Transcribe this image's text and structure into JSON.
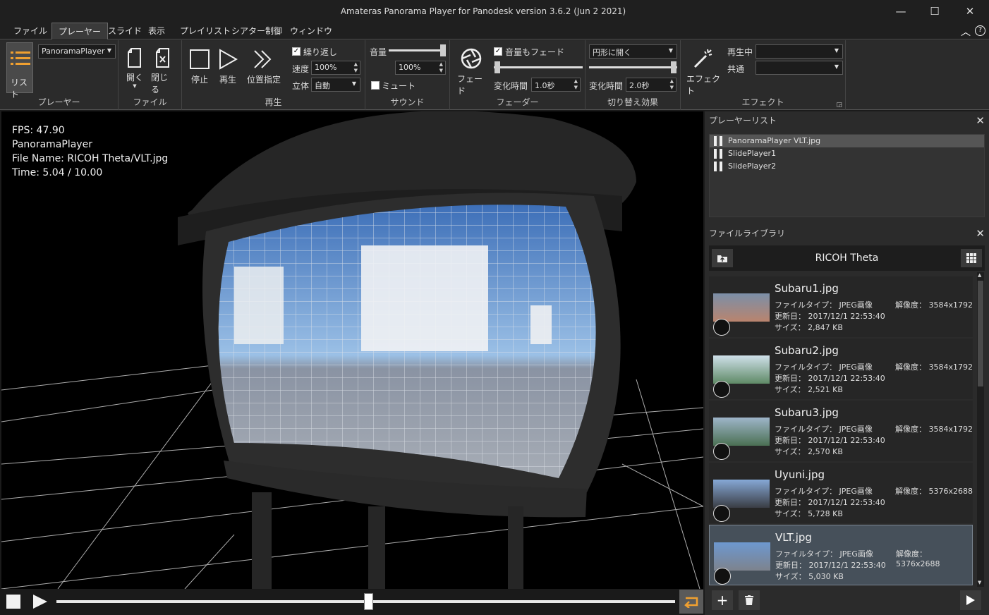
{
  "app": {
    "title": "Amateras Panorama Player for Panodesk version 3.6.2 (Jun  2 2021)"
  },
  "window": {
    "minimize": "—",
    "maximize": "☐",
    "close": "✕"
  },
  "menu": {
    "items": [
      "ファイル",
      "プレーヤー",
      "スライド",
      "表示",
      "プレイリスト",
      "シアター制御",
      "ウィンドウ"
    ],
    "active": "プレーヤー"
  },
  "ribbon": {
    "player": {
      "list_label": "リスト",
      "player_select": "PanoramaPlayer",
      "group": "プレーヤー"
    },
    "file": {
      "open": "開く",
      "close": "閉じる",
      "group": "ファイル"
    },
    "playback": {
      "stop": "停止",
      "play": "再生",
      "seek": "位置指定",
      "loop": "繰り返し",
      "speed_label": "速度",
      "speed_value": "100%",
      "stereo_label": "立体",
      "stereo_value": "自動",
      "group": "再生"
    },
    "sound": {
      "volume_label": "音量",
      "volume_value": "100%",
      "volume_level": 1.0,
      "mute": "ミュート",
      "group": "サウンド"
    },
    "fader": {
      "fade": "フェード",
      "fade_volume": "音量もフェード",
      "time_label": "変化時間",
      "time_value": "1.0秒",
      "group": "フェーダー"
    },
    "transition": {
      "mode": "円形に開く",
      "time_label": "変化時間",
      "time_value": "2.0秒",
      "group": "切り替え効果"
    },
    "effect": {
      "effect": "エフェクト",
      "playing_label": "再生中",
      "shared_label": "共通",
      "group": "エフェクト"
    }
  },
  "overlay": {
    "fps": "FPS: 47.90",
    "player": "PanoramaPlayer",
    "file": "File Name: RICOH Theta/VLT.jpg",
    "time": "Time: 5.04 / 10.00"
  },
  "transport": {
    "progress": 0.504
  },
  "player_list": {
    "title": "プレーヤーリスト",
    "items": [
      "PanoramaPlayer  VLT.jpg",
      "SlidePlayer1",
      "SlidePlayer2"
    ]
  },
  "library": {
    "title": "ファイルライブラリ",
    "folder": "RICOH Theta",
    "labels": {
      "type": "ファイルタイプ：",
      "date": "更新日：",
      "size": "サイズ：",
      "res": "解像度："
    },
    "files": [
      {
        "name": "Subaru1.jpg",
        "type": "JPEG画像",
        "date": "2017/12/1 22:53:40",
        "size": "2,847 KB",
        "res": "3584x1792"
      },
      {
        "name": "Subaru2.jpg",
        "type": "JPEG画像",
        "date": "2017/12/1 22:53:40",
        "size": "2,521 KB",
        "res": "3584x1792"
      },
      {
        "name": "Subaru3.jpg",
        "type": "JPEG画像",
        "date": "2017/12/1 22:53:40",
        "size": "2,570 KB",
        "res": "3584x1792"
      },
      {
        "name": "Uyuni.jpg",
        "type": "JPEG画像",
        "date": "2017/12/1 22:53:40",
        "size": "5,728 KB",
        "res": "5376x2688"
      },
      {
        "name": "VLT.jpg",
        "type": "JPEG画像",
        "date": "2017/12/1 22:53:40",
        "size": "5,030 KB",
        "res": "5376x2688"
      }
    ]
  },
  "colors": {
    "accent": "#f0a030",
    "background": "#2b2b2b"
  }
}
